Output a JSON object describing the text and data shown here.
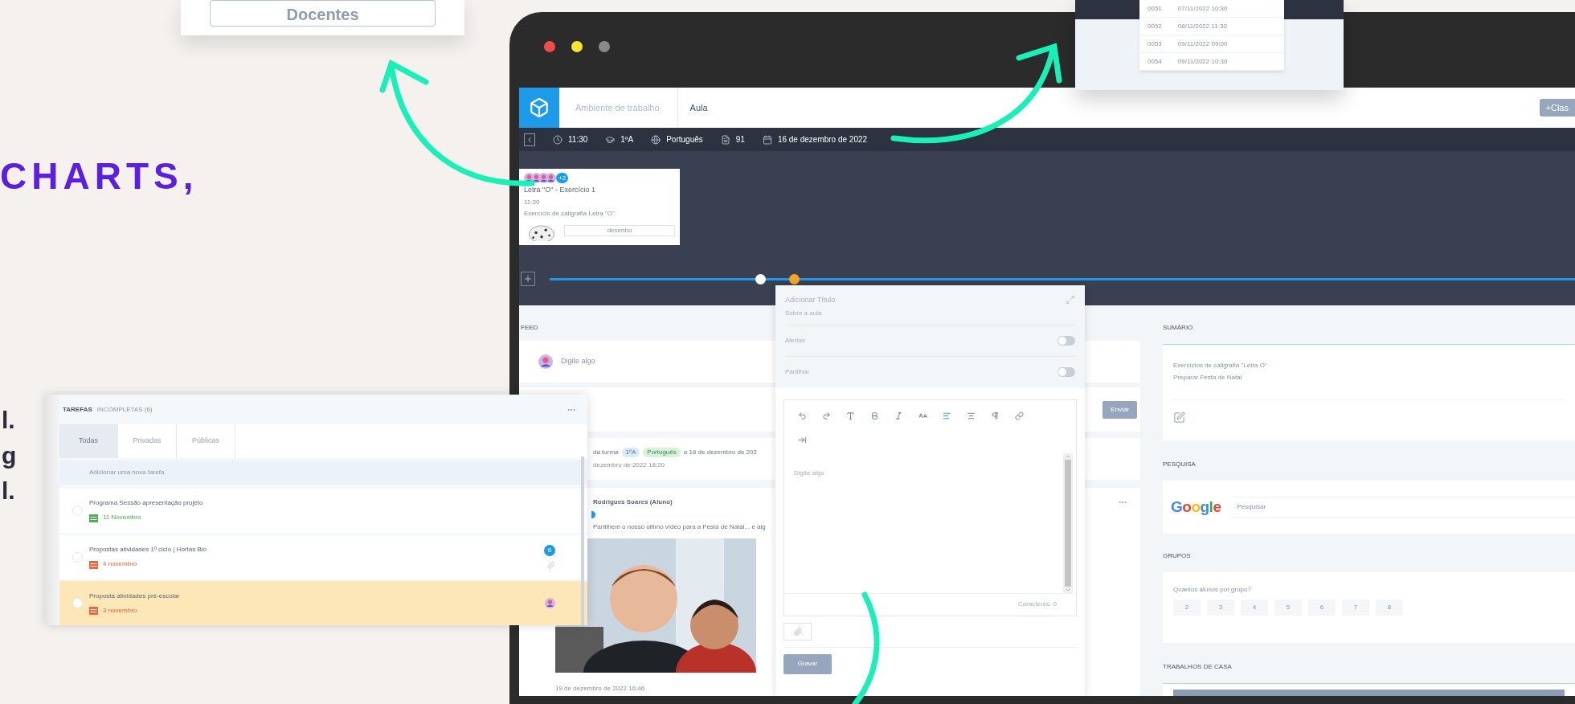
{
  "docentes_card": {
    "button": "Docentes"
  },
  "headline": "CHARTS,",
  "cut_text": [
    "l.",
    "g",
    "l."
  ],
  "sessions_card": {
    "rows": [
      {
        "id": "0051",
        "date": "07/11/2022 10:30"
      },
      {
        "id": "0052",
        "date": "08/11/2022 11:30"
      },
      {
        "id": "0053",
        "date": "09/11/2022 09:00"
      },
      {
        "id": "0054",
        "date": "09/11/2022 10:30"
      }
    ]
  },
  "app": {
    "breadcrumb": [
      "Ambiente de trabalho",
      "Aula"
    ],
    "add_button": "+Clas",
    "lesson_bar": [
      {
        "kind": "clock",
        "text": "11:30"
      },
      {
        "kind": "class",
        "text": "1ºA"
      },
      {
        "kind": "subject",
        "text": "Português"
      },
      {
        "kind": "number",
        "text": "91"
      },
      {
        "kind": "date",
        "text": "16 de dezembro de 2022"
      }
    ],
    "lesson_card": {
      "badge": "+2",
      "title": "Letra \"O\" - Exercício 1",
      "time": "11:30",
      "description": "Exercício de caligrafia Letra \"O\"",
      "field": "desenho"
    },
    "timeline": [
      {
        "selected": false
      },
      {
        "selected": true
      }
    ],
    "feed": {
      "label": "FEED",
      "placeholder": "Digite algo",
      "send_button": "Enviar",
      "notice": {
        "prefix": "da turma",
        "tags": [
          {
            "text": "1ºA",
            "color": "#d6ecf7"
          },
          {
            "text": "Português",
            "color": "#d4f5d4"
          }
        ],
        "suffix": "a 16 de dezembro de 202",
        "date": "dezembro de 2022 18:20"
      },
      "post": {
        "author": "Rodrigues Soares (Aluno)",
        "text": "Partilhem o nosso último vídeo para a Festa de Natal... e alg",
        "date": "19 de dezembro de 2022 16:46"
      }
    },
    "editor": {
      "title_placeholder": "Adicionar Título",
      "subtitle": "Sobre a aula",
      "toggles": [
        {
          "label": "Alertas",
          "on": false
        },
        {
          "label": "Partilhar",
          "on": false
        }
      ],
      "tools": [
        {
          "kind": "undo",
          "selected": false
        },
        {
          "kind": "redo",
          "selected": false
        },
        {
          "kind": "text",
          "selected": false
        },
        {
          "kind": "bold",
          "selected": false
        },
        {
          "kind": "italic",
          "selected": false
        },
        {
          "kind": "font-size",
          "selected": false
        },
        {
          "kind": "align-left",
          "selected": true
        },
        {
          "kind": "align-center",
          "selected": false
        },
        {
          "kind": "paragraph",
          "selected": false
        },
        {
          "kind": "link",
          "selected": false
        },
        {
          "kind": "insert",
          "selected": false
        }
      ],
      "placeholder": "Digite algo",
      "counter": "Caracteres: 0",
      "save_button": "Gravar"
    },
    "sidebar": {
      "summary": {
        "label": "SUMÁRIO",
        "lines": [
          "Exercícios de caligrafia \"Letra O\"",
          "Preparar Festa de Natal"
        ]
      },
      "search": {
        "label": "PESQUISA",
        "logo": "Google",
        "placeholder": "Pesquisar"
      },
      "groups": {
        "label": "GRUPOS",
        "question": "Quantos alunos por grupo?",
        "options": [
          "2",
          "3",
          "4",
          "5",
          "6",
          "7",
          "8"
        ]
      },
      "homework": {
        "label": "TRABALHOS DE CASA"
      }
    }
  },
  "tasks": {
    "title": "TAREFAS",
    "subtitle": "INCOMPLETAS (6)",
    "tabs": [
      {
        "label": "Todas",
        "selected": true
      },
      {
        "label": "Privadas",
        "selected": false
      },
      {
        "label": "Públicas",
        "selected": false
      }
    ],
    "add_placeholder": "Adicionar uma nova tarefa",
    "items": [
      {
        "title": "Programa Sessão apresentação projeto",
        "due": "11 Novembro",
        "color": "#4caf50",
        "highlighted": false
      },
      {
        "title": "Propostas atividades 1º ciclo | Hortas Bio",
        "due": "4 novembro",
        "color": "#f0643c",
        "highlighted": false,
        "badge": "6",
        "attachment": true
      },
      {
        "title": "Proposta atividades pré-escolar",
        "due": "3 novembro",
        "color": "#f0643c",
        "highlighted": true,
        "avatar": true
      }
    ]
  }
}
